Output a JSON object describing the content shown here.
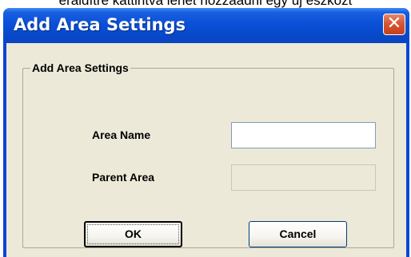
{
  "background_caption": "eráldítre kattintva lehet hozzáadni egy új eszközt",
  "window": {
    "title": "Add Area Settings",
    "close_glyph": "✕"
  },
  "group": {
    "legend": "Add Area Settings"
  },
  "fields": {
    "area_name_label": "Area Name",
    "area_name_value": "",
    "parent_area_label": "Parent Area",
    "parent_area_value": ""
  },
  "buttons": {
    "ok_label": "OK",
    "cancel_label": "Cancel"
  },
  "colors": {
    "titlebar": "#0a50d8",
    "client": "#ece9d8",
    "close_button": "#d6532f"
  },
  "icons": {
    "close": "close-icon"
  }
}
